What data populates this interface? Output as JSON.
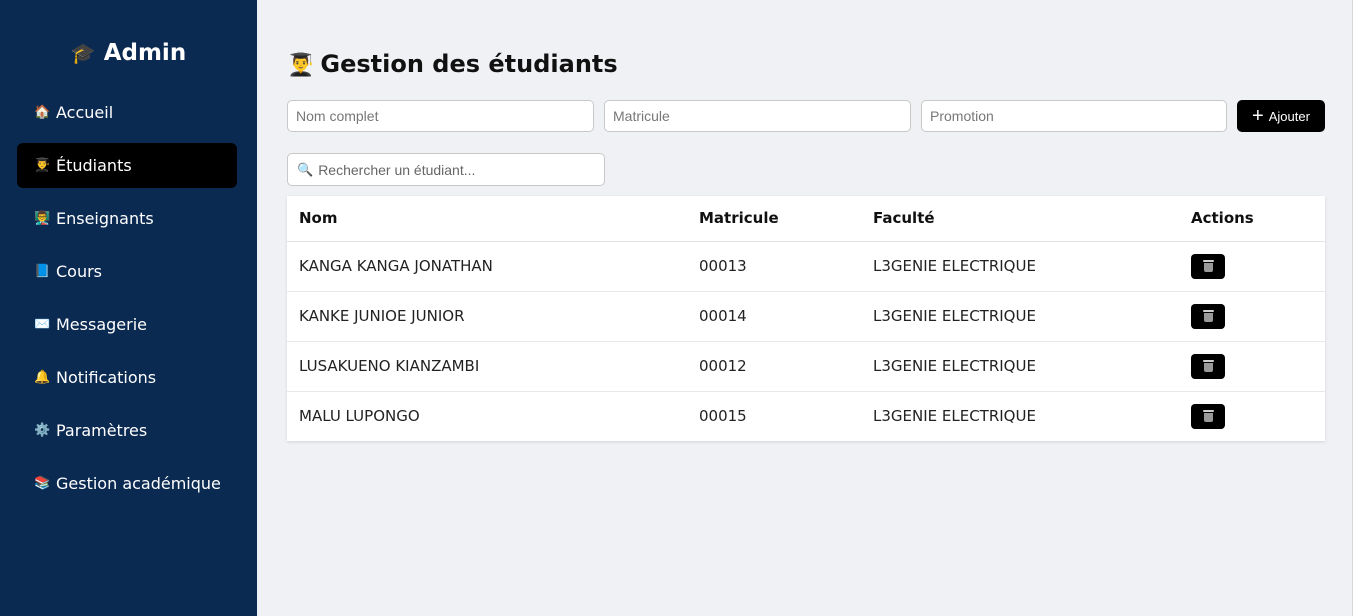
{
  "sidebar": {
    "brand": {
      "icon": "🎓",
      "label": "Admin"
    },
    "items": [
      {
        "icon": "🏠",
        "label": "Accueil",
        "active": false
      },
      {
        "icon": "👨‍🎓",
        "label": "Étudiants",
        "active": true
      },
      {
        "icon": "👨‍🏫",
        "label": "Enseignants",
        "active": false
      },
      {
        "icon": "📘",
        "label": "Cours",
        "active": false
      },
      {
        "icon": "✉️",
        "label": "Messagerie",
        "active": false
      },
      {
        "icon": "🔔",
        "label": "Notifications",
        "active": false
      },
      {
        "icon": "⚙️",
        "label": "Paramètres",
        "active": false
      },
      {
        "icon": "📚",
        "label": "Gestion académique",
        "active": false
      }
    ]
  },
  "main": {
    "title_icon": "👨‍🎓",
    "title": "Gestion des étudiants",
    "form": {
      "nom_placeholder": "Nom complet",
      "matricule_placeholder": "Matricule",
      "promotion_placeholder": "Promotion",
      "add_icon": "+",
      "add_label": "Ajouter"
    },
    "search": {
      "icon": "🔍",
      "placeholder": "Rechercher un étudiant..."
    },
    "table": {
      "headers": {
        "nom": "Nom",
        "matricule": "Matricule",
        "faculte": "Faculté",
        "actions": "Actions"
      },
      "rows": [
        {
          "nom": "KANGA KANGA JONATHAN",
          "matricule": "00013",
          "faculte": "L3GENIE ELECTRIQUE"
        },
        {
          "nom": "KANKE JUNIOE JUNIOR",
          "matricule": "00014",
          "faculte": "L3GENIE ELECTRIQUE"
        },
        {
          "nom": "LUSAKUENO KIANZAMBI",
          "matricule": "00012",
          "faculte": "L3GENIE ELECTRIQUE"
        },
        {
          "nom": "MALU LUPONGO",
          "matricule": "00015",
          "faculte": "L3GENIE ELECTRIQUE"
        }
      ]
    }
  },
  "colors": {
    "sidebar_bg": "#0b2a52",
    "active_item_bg": "#000000",
    "page_bg": "#f0f1f5",
    "button_bg": "#000000"
  }
}
